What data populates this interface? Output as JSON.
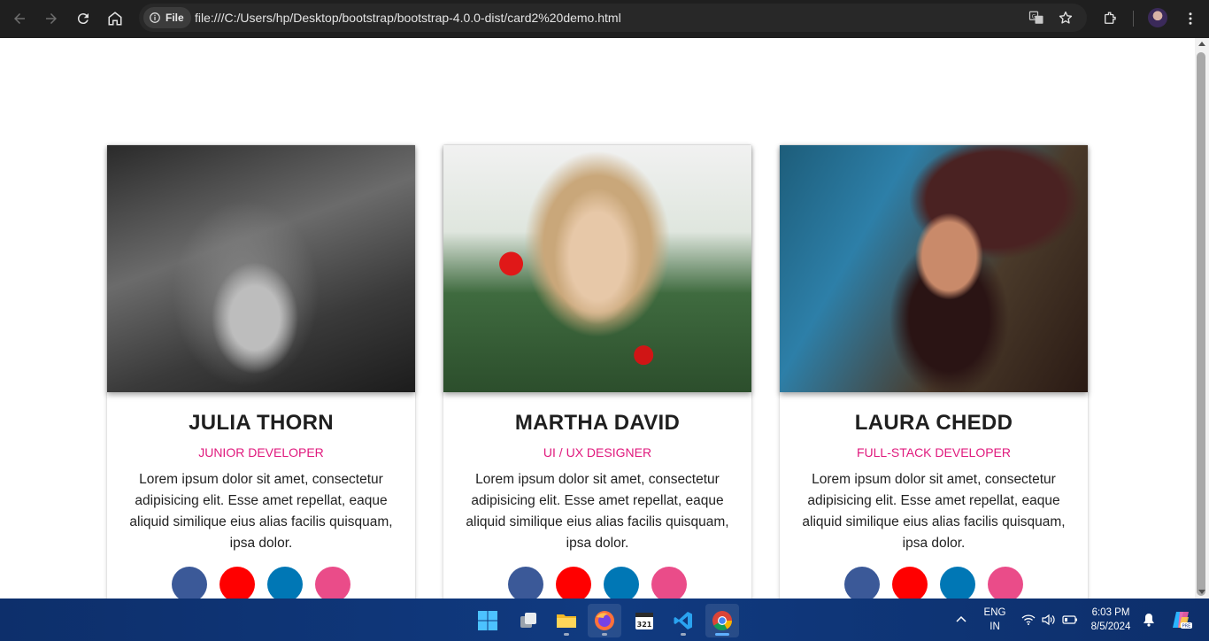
{
  "browser": {
    "site_chip_label": "File",
    "url": "file:///C:/Users/hp/Desktop/bootstrap/bootstrap-4.0.0-dist/card2%20demo.html"
  },
  "cards": [
    {
      "name": "JULIA THORN",
      "role": "JUNIOR DEVELOPER",
      "text": "Lorem ipsum dolor sit amet, consectetur adipisicing elit. Esse amet repellat, eaque aliquid similique eius alias facilis quisquam, ipsa dolor."
    },
    {
      "name": "MARTHA DAVID",
      "role": "UI / UX DESIGNER",
      "text": "Lorem ipsum dolor sit amet, consectetur adipisicing elit. Esse amet repellat, eaque aliquid similique eius alias facilis quisquam, ipsa dolor."
    },
    {
      "name": "LAURA CHEDD",
      "role": "FULL-STACK DEVELOPER",
      "text": "Lorem ipsum dolor sit amet, consectetur adipisicing elit. Esse amet repellat, eaque aliquid similique eius alias facilis quisquam, ipsa dolor."
    }
  ],
  "social_colors": [
    "#3b5998",
    "#ff0000",
    "#0077b5",
    "#ea4c89"
  ],
  "taskbar": {
    "language_line1": "ENG",
    "language_line2": "IN",
    "time": "6:03 PM",
    "date": "8/5/2024",
    "calendar_badge": "321"
  }
}
